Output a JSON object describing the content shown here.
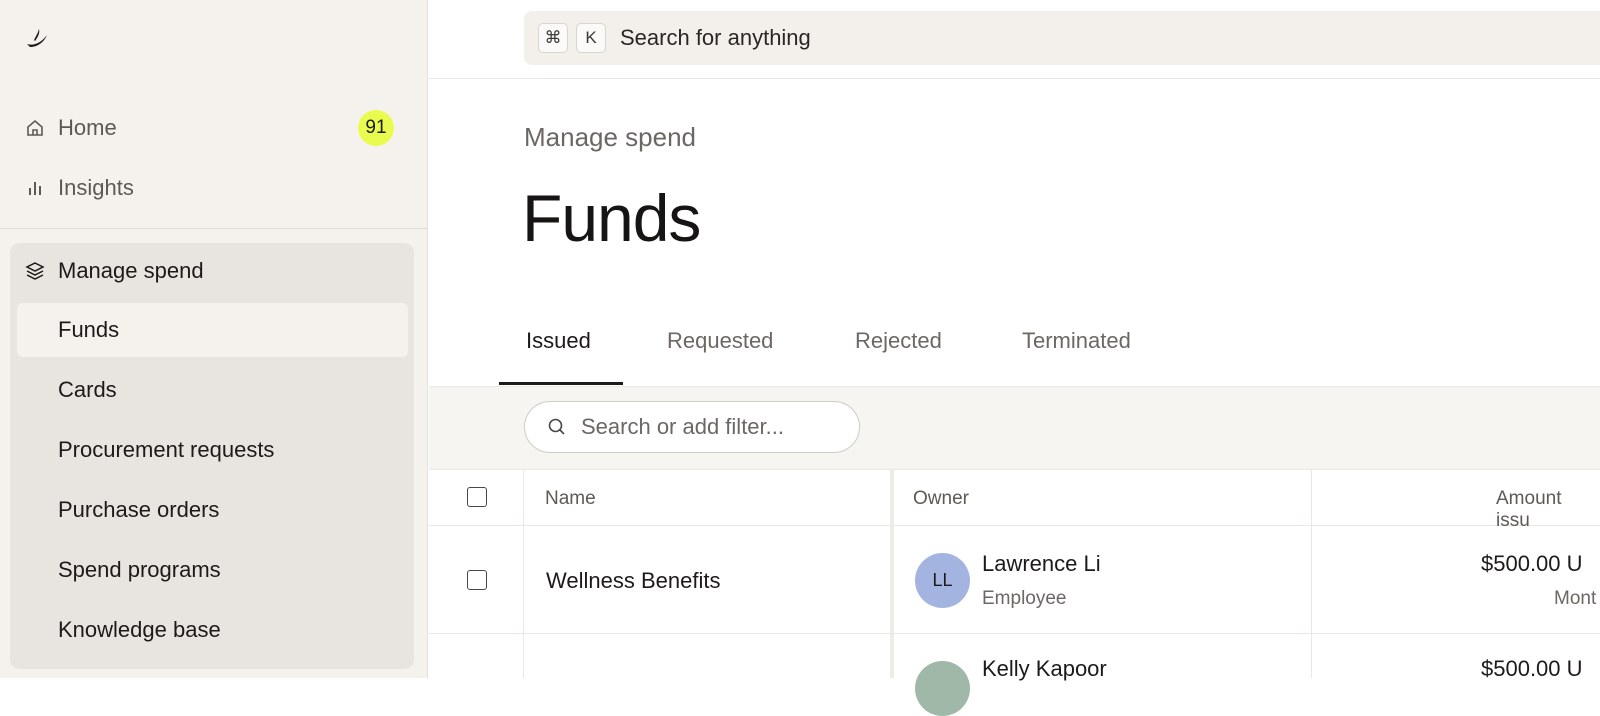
{
  "sidebar": {
    "logo": "brand-logo",
    "top_items": [
      {
        "label": "Home",
        "icon": "home-icon",
        "badge": "91"
      },
      {
        "label": "Insights",
        "icon": "bar-chart-icon"
      }
    ],
    "group": {
      "label": "Manage spend",
      "icon": "layers-icon",
      "items": [
        {
          "label": "Funds",
          "active": true
        },
        {
          "label": "Cards"
        },
        {
          "label": "Procurement requests"
        },
        {
          "label": "Purchase orders"
        },
        {
          "label": "Spend programs"
        },
        {
          "label": "Knowledge base"
        }
      ]
    }
  },
  "topbar": {
    "shortcut_keys": [
      "⌘",
      "K"
    ],
    "search_text": "Search for anything"
  },
  "page": {
    "breadcrumb": "Manage spend",
    "title": "Funds"
  },
  "tabs": [
    {
      "label": "Issued",
      "active": true
    },
    {
      "label": "Requested"
    },
    {
      "label": "Rejected"
    },
    {
      "label": "Terminated"
    }
  ],
  "filter": {
    "placeholder": "Search or add filter..."
  },
  "table": {
    "columns": [
      "Name",
      "Owner",
      "Amount issu"
    ],
    "rows": [
      {
        "name": "Wellness Benefits",
        "owner": "Lawrence Li",
        "initials": "LL",
        "role": "Employee",
        "amount": "$500.00 U",
        "period": "Mont",
        "avatar_color": "#a3b4e0"
      },
      {
        "name": "",
        "owner": "Kelly Kapoor",
        "initials": "",
        "role": "",
        "amount": "$500.00 U",
        "period": "",
        "avatar_color": "#9fb8a8"
      }
    ]
  },
  "colors": {
    "sidebar_bg": "#f5f2ee",
    "group_bg": "#e8e4e0",
    "badge": "#e8fb4e",
    "text": "#1c1b19"
  }
}
